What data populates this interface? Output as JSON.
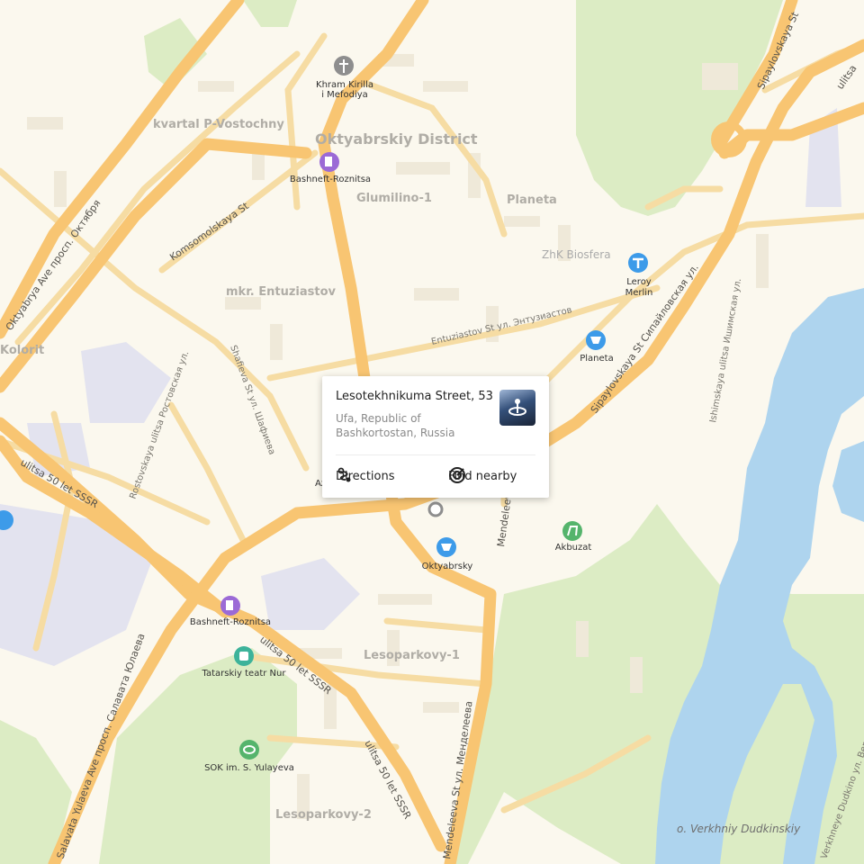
{
  "map": {
    "districts": {
      "kvartal": "kvartal P-Vostochny",
      "oktyabrskiy": "Oktyabrskiy District",
      "glumilino": "Glumilino-1",
      "planeta": "Planeta",
      "entuziastov": "mkr. Entuziastov",
      "kolorit": "Kolorit",
      "lesoparkovy1": "Lesoparkovy-1",
      "lesoparkovy2": "Lesoparkovy-2",
      "biosfera": "ZhK Biosfera"
    },
    "streets": {
      "oktyabrya": "Oktyabrya Ave  просп. Октября",
      "komsomolskaya": "Komsomolskaya St",
      "entuziastov": "Entuziastov St  ул. Энтузиастов",
      "shafieva": "Shafieva St  ул. Шафиева",
      "rostovskaya": "Rostovskaya ulitsa  Ростовская ул.",
      "ssr1": "ulitsa 50 let SSSR",
      "ssr2": "ulitsa 50 let SSSR",
      "ssr3": "ulitsa 50 let SSSR",
      "yulaeva": "Salavata Yulaeva Ave  просп. Салавата Юлаева",
      "mendeleeva": "Mendeleeva St  ул. Менделеева",
      "sipaylovskaya1": "Sipaylovskaya St  Сипайловская ул.",
      "sipaylovskaya2": "Sipaylovskaya St",
      "ishimskaya": "Ishimskaya ulitsa  Ишимская ул.",
      "verkhneye": "Verkhneye Dudkino  ул. Верхнее Дудкино",
      "ulitsa_top": "ulitsa"
    },
    "pois": {
      "khram_line1": "Khram Kirilla",
      "khram_line2": "i Mefodiya",
      "bashneft1": "Bashneft-Roznitsa",
      "bashneft2": "Bashneft-Roznitsa",
      "leroy_line1": "Leroy",
      "leroy_line2": "Merlin",
      "planeta": "Planeta",
      "oktyabrsky": "Oktyabrsky",
      "akbuzat": "Akbuzat",
      "tatarskiy": "Tatarskiy teatr Nur",
      "sok": "SOK im. S. Yulayeva",
      "az": "Az"
    },
    "island": "o. Verkhniy Dudkinskiy"
  },
  "popup": {
    "title": "Lesotekhnikuma Street, 53",
    "address": "Ufa, Republic of Bashkortostan, Russia",
    "directions_label": "Directions",
    "find_nearby_label": "Find nearby"
  },
  "colors": {
    "background": "#fbf8ee",
    "major_road": "#f8c572",
    "minor_road": "#f6dca3",
    "park": "#dcecc4",
    "water": "#aed4ee",
    "industrial": "#e3e3ef",
    "poi_blue": "#3d9be9",
    "poi_purple": "#9b6ad6",
    "poi_green": "#55b46c",
    "poi_gray": "#8e8e8e"
  }
}
